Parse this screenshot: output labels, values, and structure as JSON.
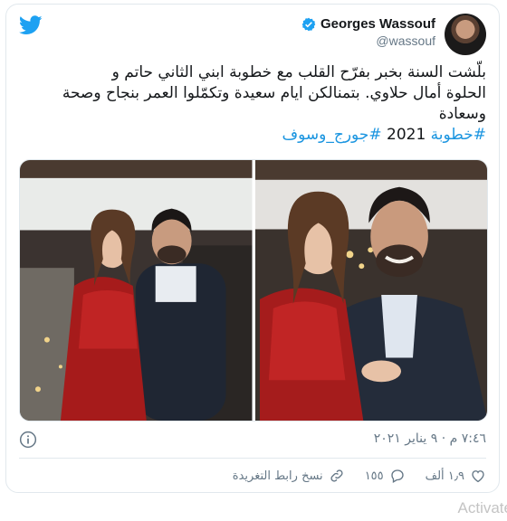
{
  "header": {
    "display_name": "Georges Wassouf",
    "handle": "@wassouf"
  },
  "tweet": {
    "line1": "بلّشت السنة بخبر بفرّح القلب مع خطوبة ابني الثاني حاتم و",
    "line2": "الحلوة أمال حلاوي. بتمنالكن ايام سعيدة وتكمّلوا العمر بنجاح وصحة",
    "line3": "وسعادة",
    "hashtag1": "#خطوبة",
    "hashtag1_suffix": " 2021",
    "hashtag2": "#جورج_وسوف"
  },
  "meta": {
    "timestamp": "٧:٤٦ م · ٩ يناير ٢٠٢١"
  },
  "actions": {
    "likes": "١٫٩ ألف",
    "replies": "١٥٥",
    "copy_link": "نسخ رابط التغريدة"
  },
  "watermark": "Activate",
  "colors": {
    "accent": "#1da1f2",
    "hashtag": "#1b95e0",
    "muted": "#657786",
    "border": "#e1e8ed"
  },
  "icons": [
    "twitter-bird-icon",
    "verified-badge-icon",
    "info-icon",
    "heart-icon",
    "reply-icon",
    "link-icon"
  ]
}
